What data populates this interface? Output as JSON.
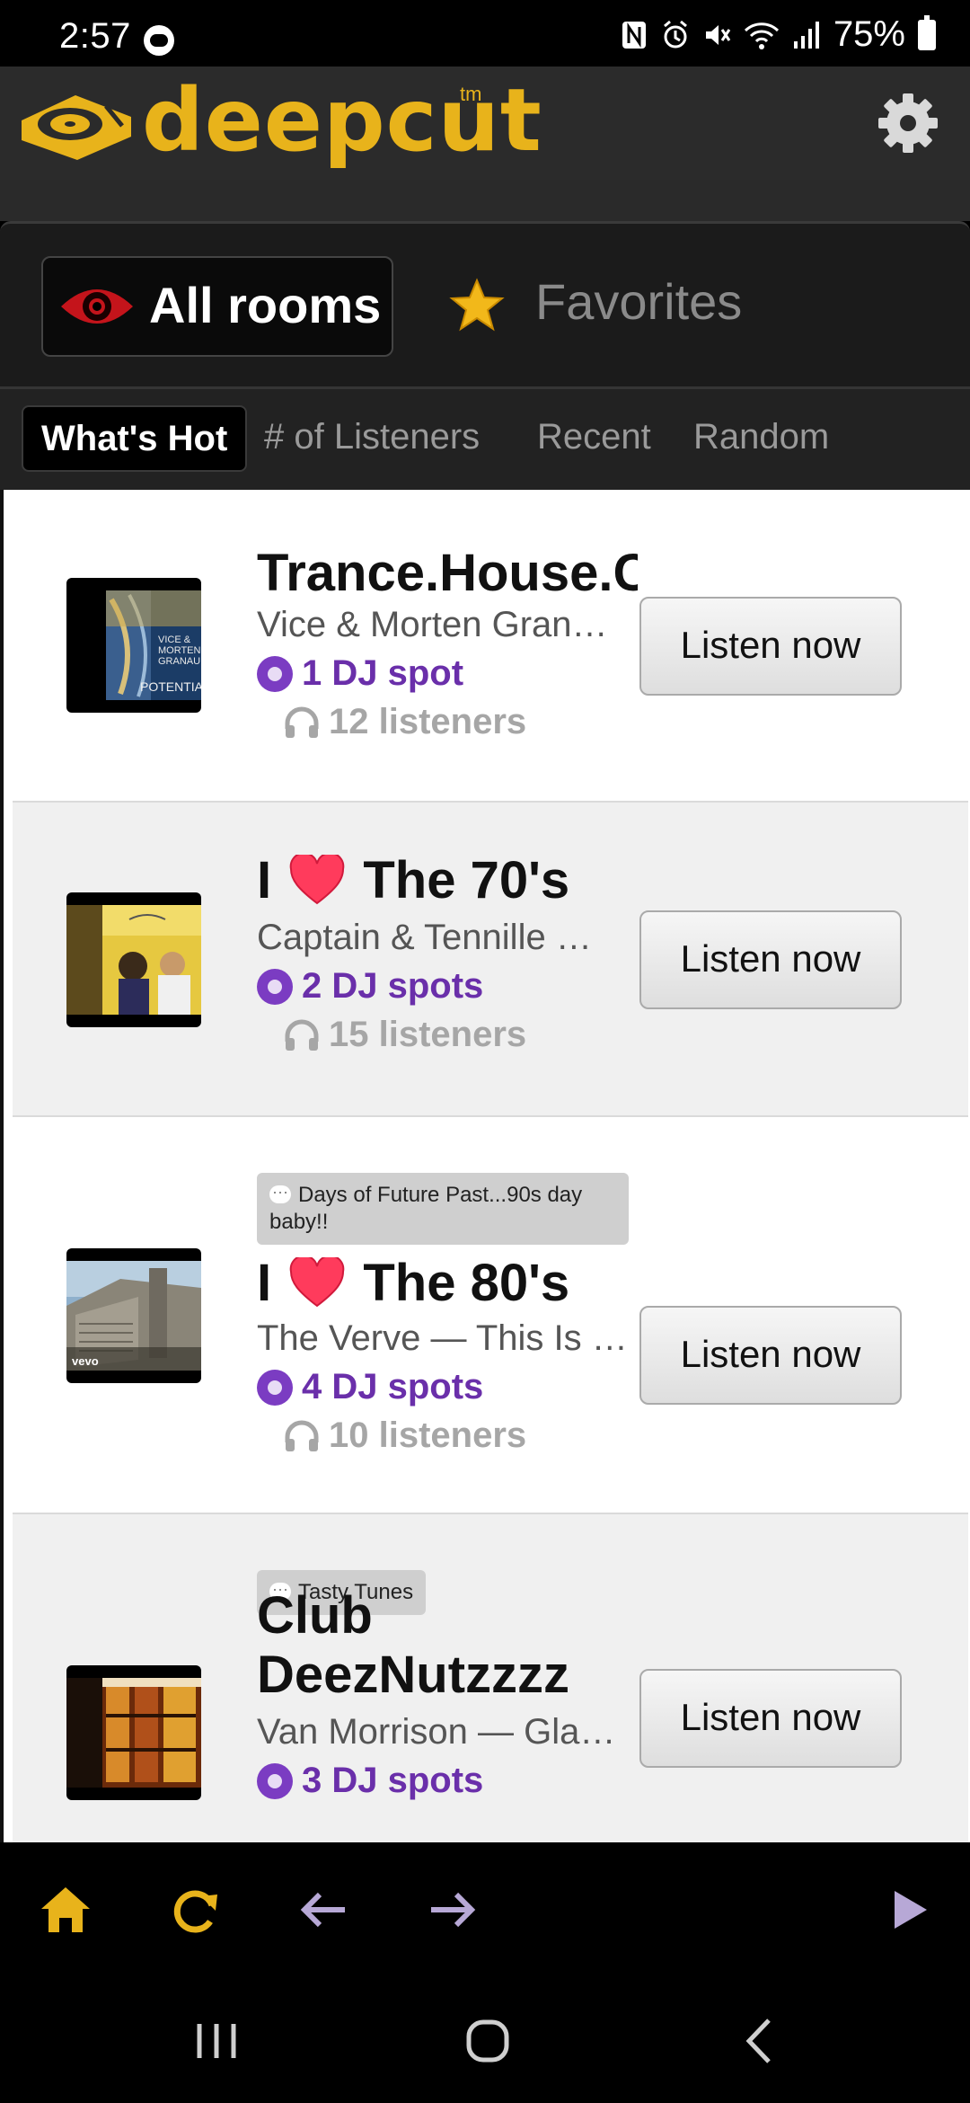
{
  "status_bar": {
    "time": "2:57",
    "battery": "75%"
  },
  "header": {
    "logo_text": "deepcut",
    "logo_tm": "tm"
  },
  "room_tabs": {
    "all_rooms": "All rooms",
    "favorites": "Favorites"
  },
  "sort_tabs": {
    "whats_hot": "What's Hot",
    "listeners": "# of Listeners",
    "recent": "Recent",
    "random": "Random"
  },
  "rooms": [
    {
      "title": "Trance.House.C",
      "song": "Vice & Morten Gran…",
      "dj": "1 DJ spot",
      "listeners": "12 listeners",
      "button": "Listen now"
    },
    {
      "title_prefix": "I",
      "title_suffix": "The 70's",
      "song": "Captain & Tennille …",
      "dj": "2 DJ spots",
      "listeners": "15 listeners",
      "button": "Listen now"
    },
    {
      "message": "Days of Future Past...90s day baby!!",
      "title_prefix": "I",
      "title_suffix": "The 80's",
      "song": "The Verve — This Is …",
      "dj": "4 DJ spots",
      "listeners": "10 listeners",
      "button": "Listen now"
    },
    {
      "message": "Tasty Tunes",
      "title_line1": "Club",
      "title_line2": "DeezNutzzzz",
      "song": "Van Morrison — Gla…",
      "dj": "3 DJ spots",
      "button": "Listen now"
    }
  ],
  "album_art_text": {
    "room1": "VICE & MORTEN GRANAU POTENTIAL",
    "room3": "vevo"
  },
  "colors": {
    "brand_gold": "#e8b31b",
    "dj_purple": "#6a2faa",
    "header_bg": "#2b2b2b"
  },
  "icons": {
    "app_nav": [
      "home-icon",
      "refresh-icon",
      "back-arrow-icon",
      "forward-arrow-icon",
      "play-icon"
    ],
    "system_nav": [
      "recents-icon",
      "home-circle-icon",
      "back-chevron-icon"
    ]
  }
}
